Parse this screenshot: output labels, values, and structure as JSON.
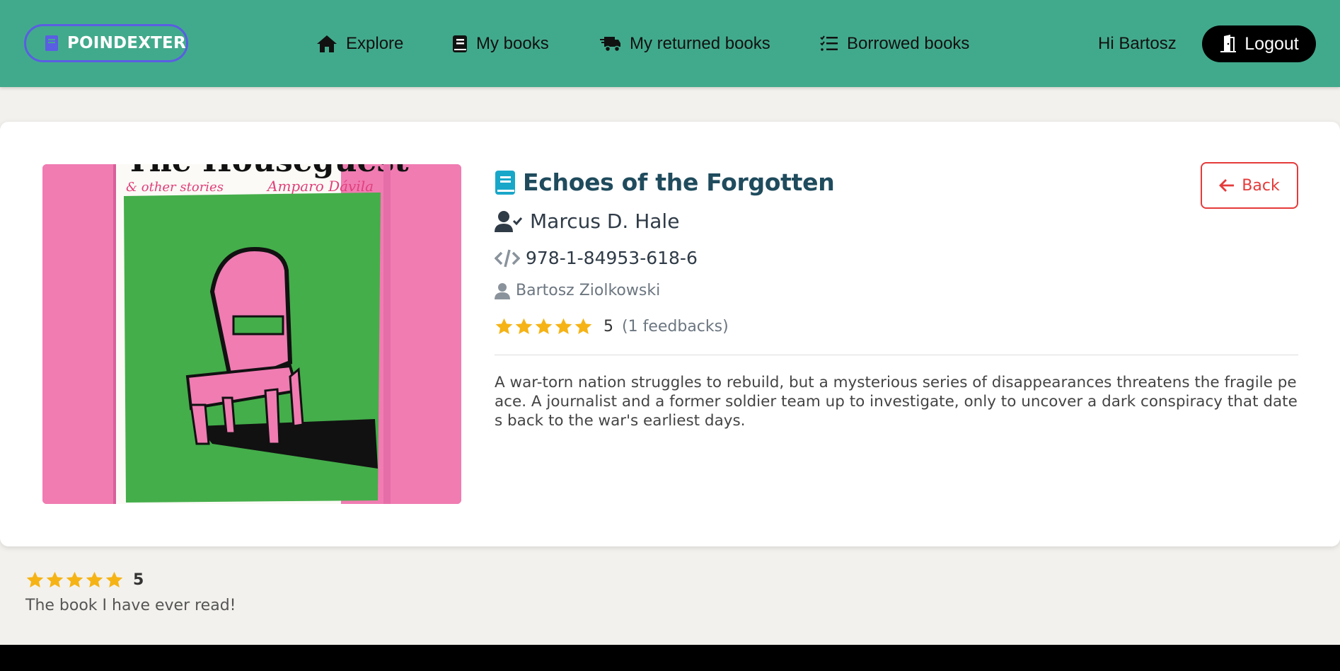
{
  "navbar": {
    "brand": "POINDEXTER",
    "links": [
      {
        "label": "Explore",
        "icon": "home-icon"
      },
      {
        "label": "My books",
        "icon": "book-icon"
      },
      {
        "label": "My returned books",
        "icon": "truck-icon"
      },
      {
        "label": "Borrowed books",
        "icon": "list-check-icon"
      }
    ],
    "greeting": "Hi Bartosz",
    "logout_label": "Logout"
  },
  "book": {
    "title": "Echoes of the Forgotten",
    "author": "Marcus D. Hale",
    "isbn": "978-1-84953-618-6",
    "owner": "Bartosz Ziolkowski",
    "rating": "5",
    "rating_stars": 5,
    "feedback_count": "(1 feedbacks)",
    "description": "A war-torn nation struggles to rebuild, but a mysterious series of disappearances threatens the fragile peace. A journalist and a former soldier team up to investigate, only to uncover a dark conspiracy that dates back to the war's earliest days.",
    "cover": {
      "title_text": "The Houseguest",
      "subtitle_text": "& other stories",
      "author_text": "Amparo Dávila"
    }
  },
  "back_label": "Back",
  "reviews": [
    {
      "stars": 5,
      "score": "5",
      "comment": "The book I have ever read!"
    }
  ],
  "colors": {
    "navbar": "#42aa8c",
    "brand_border": "#5a5ee3",
    "title": "#1f4b5d",
    "star": "#f5b315",
    "back": "#e53a3a",
    "background": "#f3f1ed"
  }
}
